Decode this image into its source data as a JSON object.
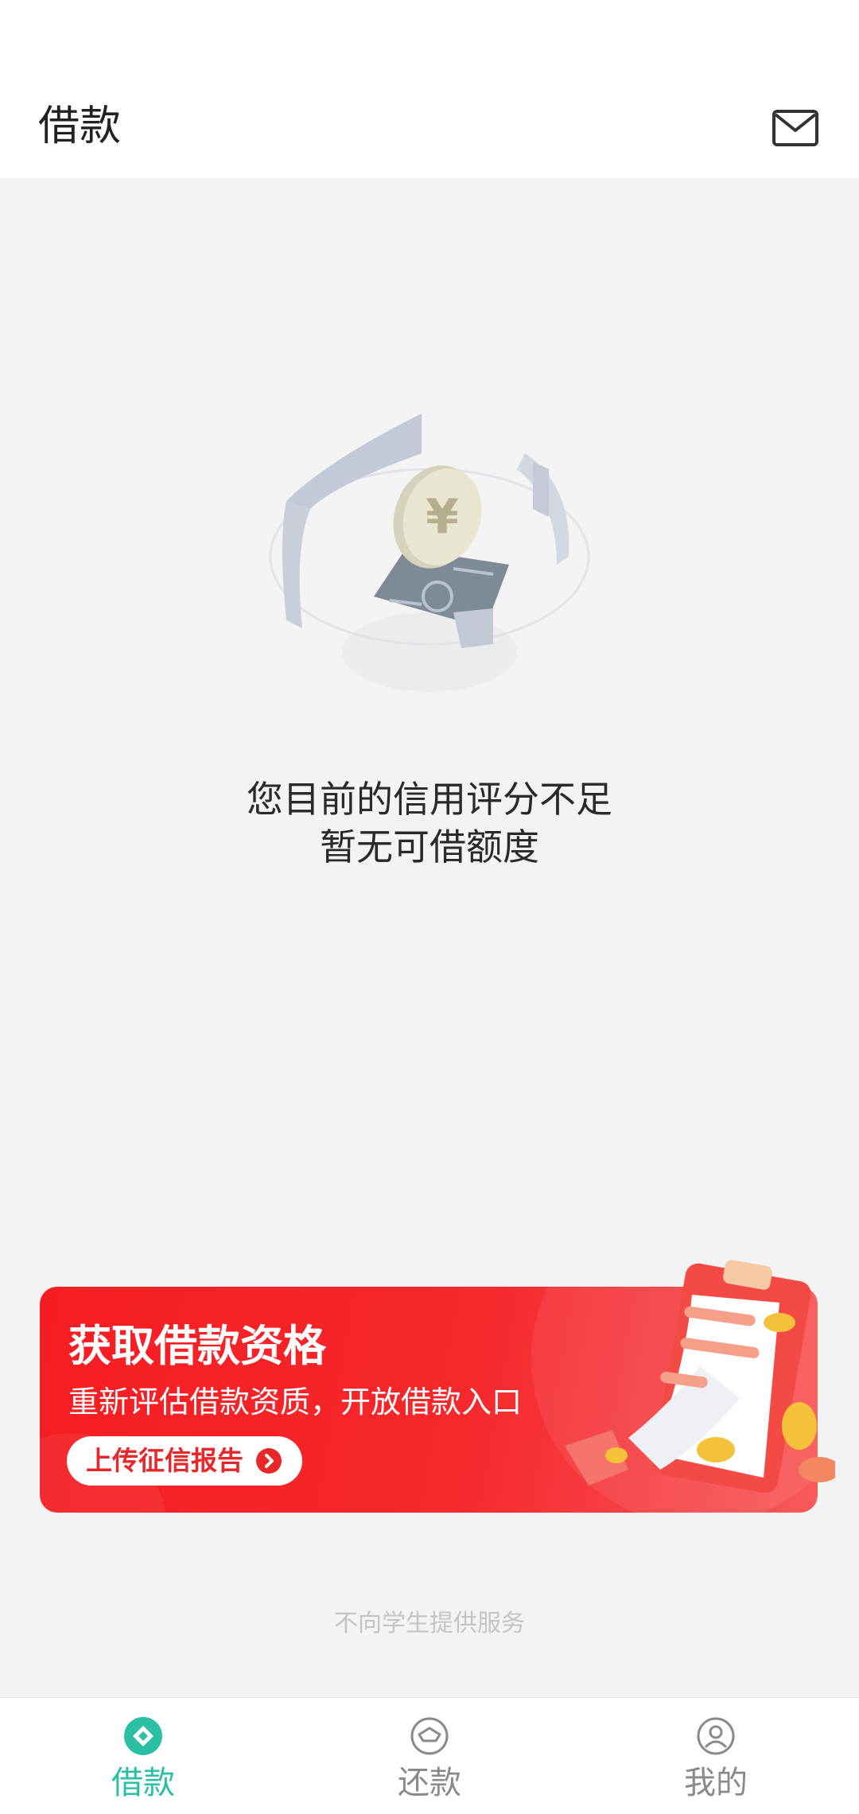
{
  "header": {
    "title": "借款",
    "mail_icon": "mail-icon"
  },
  "status": {
    "line1": "您目前的信用评分不足",
    "line2": "暂无可借额度"
  },
  "banner": {
    "title": "获取借款资格",
    "subtitle": "重新评估借款资质，开放借款入口",
    "button_label": "上传征信报告",
    "colors": {
      "bg": "#f51d22",
      "button_text": "#e8272a"
    }
  },
  "footnote": "不向学生提供服务",
  "tabbar": {
    "active_color": "#2bbfa6",
    "items": [
      {
        "label": "借款",
        "icon": "loan-icon",
        "active": true
      },
      {
        "label": "还款",
        "icon": "repay-icon",
        "active": false
      },
      {
        "label": "我的",
        "icon": "profile-icon",
        "active": false
      }
    ]
  }
}
